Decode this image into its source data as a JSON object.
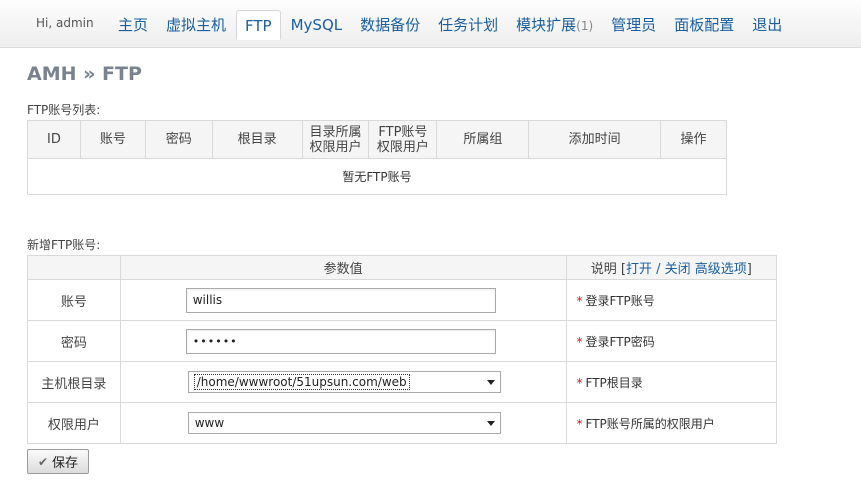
{
  "header": {
    "greeting": "Hi, admin",
    "nav": [
      {
        "label": "主页"
      },
      {
        "label": "虚拟主机"
      },
      {
        "label": "FTP",
        "active": true
      },
      {
        "label": "MySQL"
      },
      {
        "label": "数据备份"
      },
      {
        "label": "任务计划"
      },
      {
        "label": "模块扩展",
        "count": "(1)"
      },
      {
        "label": "管理员"
      },
      {
        "label": "面板配置"
      },
      {
        "label": "退出"
      }
    ]
  },
  "page": {
    "title": "AMH » FTP",
    "list_label": "FTP账号列表:",
    "new_label": "新增FTP账号:"
  },
  "list_table": {
    "columns": [
      "ID",
      "账号",
      "密码",
      "根目录",
      "目录所属\n权限用户",
      "FTP账号\n权限用户",
      "所属组",
      "添加时间",
      "操作"
    ],
    "empty_text": "暂无FTP账号"
  },
  "form_table": {
    "header_value": "参数值",
    "header_desc_prefix": "说明 [",
    "header_desc_link": "打开 / 关闭 高级选项",
    "header_desc_suffix": "]",
    "rows": [
      {
        "label": "账号",
        "value": "willis",
        "desc": "登录FTP账号"
      },
      {
        "label": "密码",
        "value": "••••••",
        "desc": "登录FTP密码"
      },
      {
        "label": "主机根目录",
        "value": "/home/wwwroot/51upsun.com/web",
        "desc": "FTP根目录"
      },
      {
        "label": "权限用户",
        "value": "www",
        "desc": "FTP账号所属的权限用户"
      }
    ],
    "required_mark": "*"
  },
  "save_label": "保存",
  "icons": {
    "save": "check-icon",
    "select": "chevron-down-icon"
  }
}
